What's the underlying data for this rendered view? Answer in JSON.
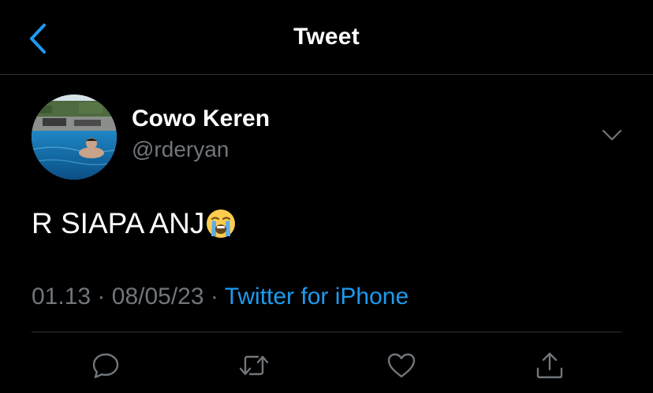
{
  "header": {
    "title": "Tweet",
    "back_icon": "chevron-left-icon"
  },
  "user": {
    "display_name": "Cowo Keren",
    "handle": "@rderyan"
  },
  "tweet": {
    "text": "R SIAPA ANJ",
    "emoji": "loudly-crying-face-emoji",
    "time": "01.13",
    "date": "08/05/23",
    "separator": "·",
    "source": "Twitter for iPhone"
  },
  "actions": [
    "reply-icon",
    "retweet-icon",
    "like-icon",
    "share-icon"
  ],
  "colors": {
    "background": "#000000",
    "text": "#ffffff",
    "muted": "#71767b",
    "accent": "#1d9bf0",
    "divider": "#2f3336"
  }
}
